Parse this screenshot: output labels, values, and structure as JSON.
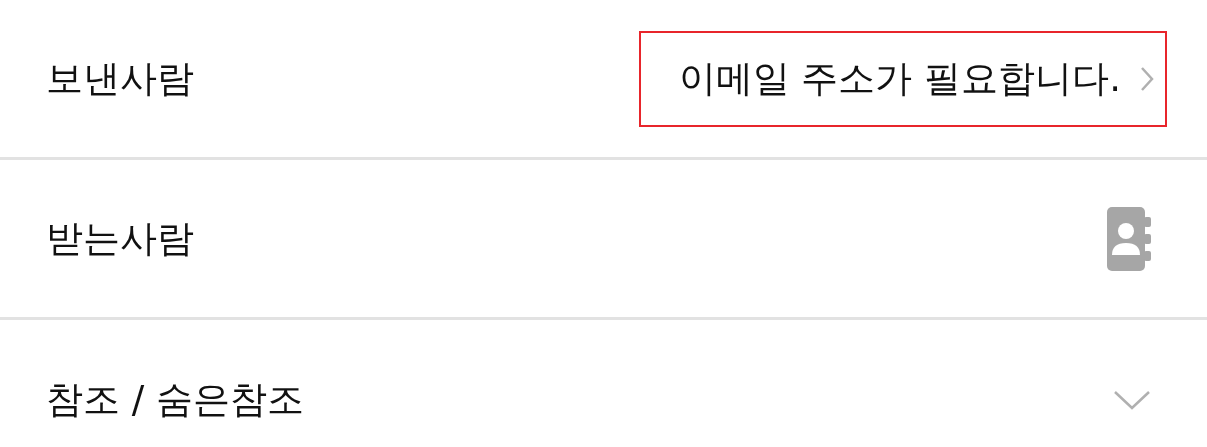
{
  "rows": [
    {
      "kind": "sender",
      "label": "보낸사람",
      "value": "이메일 주소가 필요합니다.",
      "highlighted": true
    },
    {
      "kind": "contacts",
      "label": "받는사람"
    },
    {
      "kind": "expand",
      "label": "참조 / 숨은참조",
      "expanded": false
    }
  ]
}
